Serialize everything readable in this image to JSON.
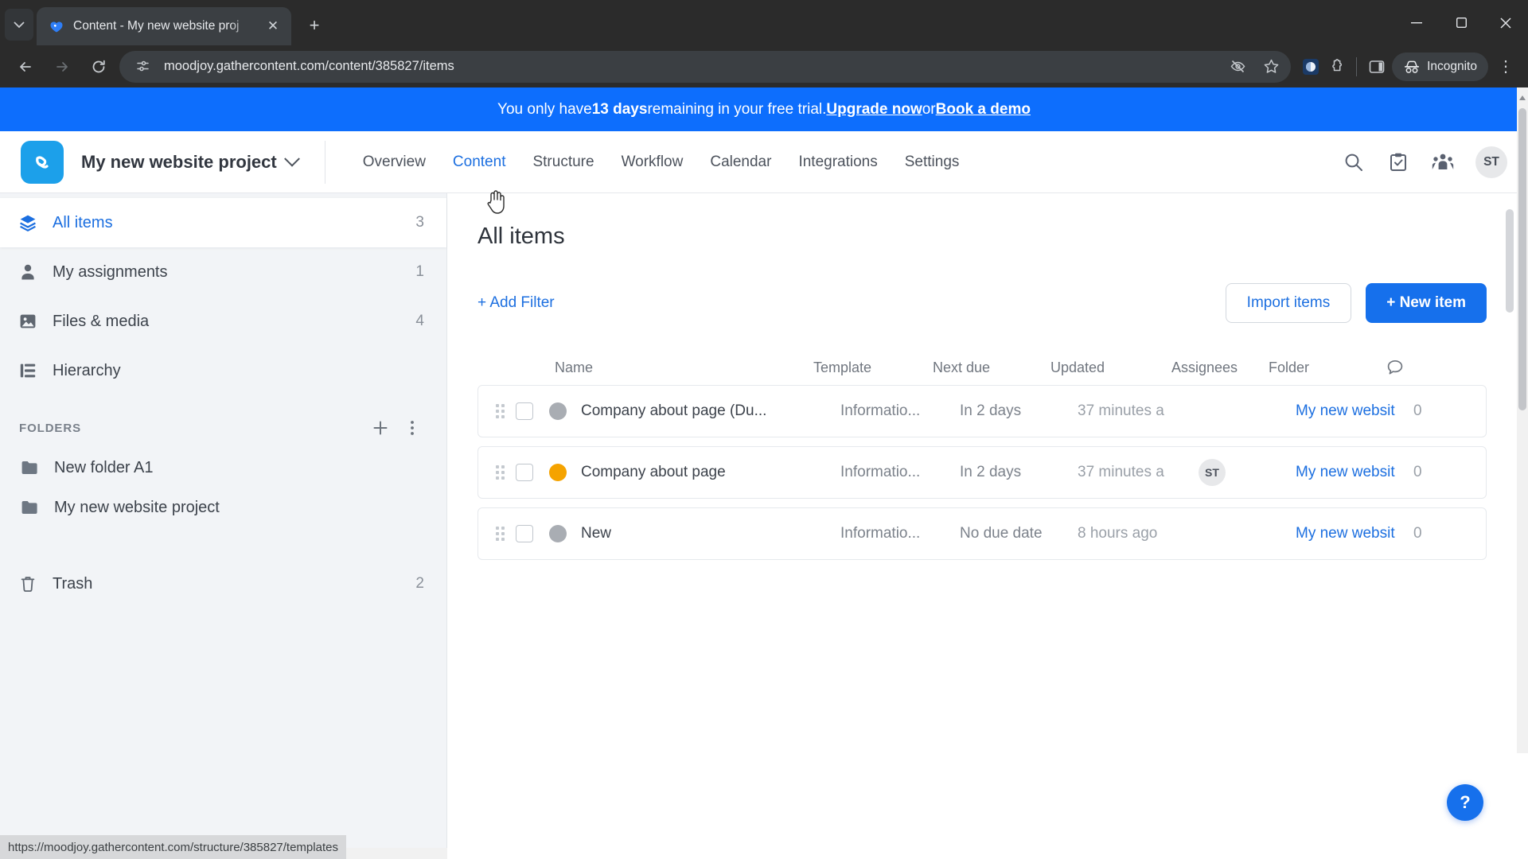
{
  "browser": {
    "tab": {
      "title": "Content - My new website proj",
      "favicon_icon": "gathercontent-favicon",
      "close_icon": "close-icon"
    },
    "tab_list_icon": "chevron-down-icon",
    "new_tab_icon": "plus-icon",
    "window_controls": {
      "minimize": "minimize-icon",
      "maximize": "maximize-icon",
      "close": "close-icon"
    },
    "back_icon": "arrow-left-icon",
    "forward_icon": "arrow-right-icon",
    "reload_icon": "reload-icon",
    "url": "moodjoy.gathercontent.com/content/385827/items",
    "site_info_icon": "page-settings-icon",
    "omnibox_icons": [
      "eye-slash-icon",
      "star-icon"
    ],
    "extension_icons": [
      "extension-puzzle-icon",
      "browser-extension-icon"
    ],
    "side_panel_icon": "side-panel-icon",
    "incognito_label": "Incognito",
    "incognito_icon": "incognito-hat-icon",
    "menu_icon": "three-dots-vertical-icon",
    "status_url": "https://moodjoy.gathercontent.com/structure/385827/templates"
  },
  "banner": {
    "prefix": "You only have ",
    "days": "13 days",
    "middle": " remaining in your free trial. ",
    "upgrade_link": "Upgrade now",
    "or": " or ",
    "demo_link": "Book a demo"
  },
  "header": {
    "logo_icon": "gathercontent-logo",
    "project_name": "My new website project",
    "project_chevron_icon": "chevron-down-icon",
    "nav": [
      {
        "label": "Overview",
        "active": false
      },
      {
        "label": "Content",
        "active": true
      },
      {
        "label": "Structure",
        "active": false
      },
      {
        "label": "Workflow",
        "active": false
      },
      {
        "label": "Calendar",
        "active": false
      },
      {
        "label": "Integrations",
        "active": false
      },
      {
        "label": "Settings",
        "active": false
      }
    ],
    "search_icon": "search-icon",
    "tasks_icon": "clipboard-check-icon",
    "team_icon": "people-group-icon",
    "avatar_initials": "ST"
  },
  "sidebar": {
    "items": [
      {
        "label": "All items",
        "count": "3",
        "icon": "layers-icon",
        "active": true
      },
      {
        "label": "My assignments",
        "count": "1",
        "icon": "person-icon",
        "active": false
      },
      {
        "label": "Files & media",
        "count": "4",
        "icon": "image-icon",
        "active": false
      },
      {
        "label": "Hierarchy",
        "count": "",
        "icon": "hierarchy-icon",
        "active": false
      }
    ],
    "folders_title": "FOLDERS",
    "add_folder_icon": "plus-icon",
    "folders_menu_icon": "three-dots-vertical-icon",
    "folders": [
      {
        "label": "New folder A1",
        "icon": "folder-icon"
      },
      {
        "label": "My new website project",
        "icon": "folder-icon"
      }
    ],
    "trash": {
      "label": "Trash",
      "count": "2",
      "icon": "trash-icon"
    }
  },
  "main": {
    "title": "All items",
    "add_filter": "+ Add Filter",
    "import_button": "Import items",
    "new_item_button": "+ New item",
    "columns": {
      "name": "Name",
      "template": "Template",
      "next_due": "Next due",
      "updated": "Updated",
      "assignees": "Assignees",
      "folder": "Folder",
      "comments_icon": "comment-bubble-icon"
    },
    "rows": [
      {
        "name": "Company about page (Du...",
        "template": "Informatio...",
        "next_due": "In 2 days",
        "updated": "37 minutes a",
        "assignee": "",
        "folder": "My new websit",
        "comments": "0",
        "status_color": "#a9adb3"
      },
      {
        "name": "Company about page",
        "template": "Informatio...",
        "next_due": "In 2 days",
        "updated": "37 minutes a",
        "assignee": "ST",
        "folder": "My new websit",
        "comments": "0",
        "status_color": "#f5a300"
      },
      {
        "name": "New",
        "template": "Informatio...",
        "next_due": "No due date",
        "updated": "8 hours ago",
        "assignee": "",
        "folder": "My new websit",
        "comments": "0",
        "status_color": "#a9adb3"
      }
    ],
    "help_button": "?"
  },
  "colors": {
    "accent_blue": "#1670ec",
    "banner_blue": "#0d6efd",
    "logo_blue": "#1ca0ea",
    "status_orange": "#f5a300",
    "status_grey": "#a9adb3"
  }
}
